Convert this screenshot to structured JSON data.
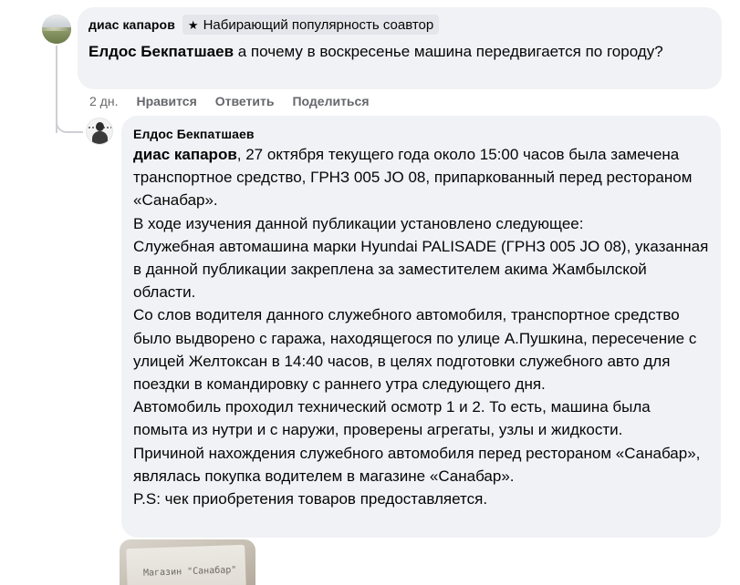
{
  "comment": {
    "author": "диас капаров",
    "badge": "Набирающий популярность соавтор",
    "mention": "Елдос Бекпатшаев",
    "text": " а почему в воскресенье машина передвигается по городу?",
    "time": "2 дн.",
    "actions": {
      "like": "Нравится",
      "reply": "Ответить",
      "share": "Поделиться"
    }
  },
  "reply": {
    "author": "Елдос Бекпатшаев",
    "mention": "диас капаров",
    "text": ", 27 октября текущего года около 15:00 часов была замечена транспортное средство, ГРНЗ 005 JO 08, припаркованный перед рестораном «Санабар».\nВ ходе изучения данной публикации установлено следующее:\nСлужебная автомашина марки Hyundai PALISADE (ГРНЗ 005 JO 08), указанная в данной публикации закреплена за заместителем акима Жамбылской области.\nСо слов водителя данного служебного автомобиля, транспортное средство было выдворено с гаража, находящегося по улице А.Пушкина, пересечение с улицей Желтоксан в 14:40 часов, в целях подготовки служебного авто для поездки в командировку с раннего утра следующего дня.\nАвтомобиль проходил технический осмотр 1 и 2. То есть, машина была помыта из нутри и с наружи, проверены агрегаты, узлы и жидкости.\nПричиной нахождения служебного автомобиля перед рестораном «Санабар», являлась покупка водителем в магазине «Санабар».\nP.S: чек приобретения товаров предоставляется.",
    "attachment_caption": "Магазин \"Санабар\""
  },
  "icons": {
    "badge": "star-icon"
  },
  "colors": {
    "bubble": "#f0f2f5",
    "meta": "#65676b",
    "badge_bg": "#e4e6eb"
  }
}
